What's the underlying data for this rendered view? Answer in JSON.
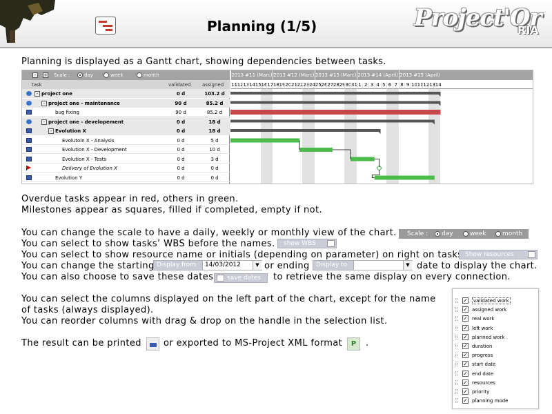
{
  "header": {
    "title": "Planning (1/5)",
    "brand": "Project'Or",
    "brand_sub": "RIA",
    "colors": {
      "bar_bg": "#a9a9a9",
      "green": "#4cbb4c",
      "red": "#c9474b",
      "summary": "#555555"
    }
  },
  "intro": "Planning is displayed as a Gantt chart, showing dependencies between tasks.",
  "gantt": {
    "scale_label": "Scale :",
    "scale_options": [
      "day",
      "week",
      "month"
    ],
    "scale_selected": "day",
    "col_task": "task",
    "col_validated": "validated",
    "col_assigned": "assigned",
    "weeks": [
      "2013 #11 (Marc)",
      "2013 #12 (Marc)",
      "2013 #13 (Marc)",
      "2013 #14 (April)",
      "2013 #15 (April)"
    ],
    "days": [
      "11",
      "12",
      "13",
      "14",
      "15",
      "16",
      "17",
      "18",
      "19",
      "20",
      "21",
      "22",
      "23",
      "24",
      "25",
      "26",
      "27",
      "28",
      "29",
      "30",
      "31",
      "1",
      "2",
      "3",
      "4",
      "5",
      "6",
      "7",
      "8",
      "9",
      "10",
      "11",
      "12",
      "13",
      "14"
    ],
    "rows": [
      {
        "name": "project one",
        "validated": "0 d",
        "assigned": "103.2 d",
        "style": "bold",
        "icon": "gear",
        "indent": 0,
        "toggle": "-"
      },
      {
        "name": "project one - maintenance",
        "validated": "90 d",
        "assigned": "85.2 d",
        "style": "bold",
        "icon": "gear",
        "indent": 1,
        "toggle": "-"
      },
      {
        "name": "bug fixing",
        "validated": "90 d",
        "assigned": "85.2 d",
        "style": "",
        "icon": "pc",
        "indent": 2,
        "toggle": ""
      },
      {
        "name": "project one - developement",
        "validated": "0 d",
        "assigned": "18 d",
        "style": "bold",
        "icon": "gear",
        "indent": 1,
        "toggle": "-"
      },
      {
        "name": "Evolution X",
        "validated": "0 d",
        "assigned": "18 d",
        "style": "bold",
        "icon": "pc",
        "indent": 2,
        "toggle": "-"
      },
      {
        "name": "Evolutoin X - Analysis",
        "validated": "0 d",
        "assigned": "5 d",
        "style": "",
        "icon": "pc",
        "indent": 3,
        "toggle": ""
      },
      {
        "name": "Evolution X - Development",
        "validated": "0 d",
        "assigned": "10 d",
        "style": "",
        "icon": "pc",
        "indent": 3,
        "toggle": ""
      },
      {
        "name": "Evolution X - Tests",
        "validated": "0 d",
        "assigned": "3 d",
        "style": "",
        "icon": "pc",
        "indent": 3,
        "toggle": ""
      },
      {
        "name": "Delivery of Evolution X",
        "validated": "0 d",
        "assigned": "0 d",
        "style": "italic",
        "icon": "flag",
        "indent": 3,
        "toggle": ""
      },
      {
        "name": "Evolution Y",
        "validated": "0 d",
        "assigned": "0 d",
        "style": "",
        "icon": "pc",
        "indent": 2,
        "toggle": ""
      }
    ]
  },
  "text": {
    "overdue": "Overdue tasks appear in red, others in green.",
    "milestones": "Milestones appear as squares, filled if completed, empty if not.",
    "scale_line": "You can change the scale to have a daily, weekly or monthly view of the chart.",
    "wbs_line": "You can select to show tasks’ WBS before the names.",
    "res_line": "You can select to show resource name or initials (depending on parameter) on right on tasks.",
    "date_line_a": "You can change the starting",
    "date_line_b": "or ending",
    "date_line_c": "date to display the chart.",
    "save_line_a": "You can also choose to save these dates",
    "save_line_b": "to retrieve the same display on every connection.",
    "cols_line1": "You can select the columns displayed on the left part of the chart, except for the name",
    "cols_line2": "of tasks (always displayed).",
    "reorder_line": "You can reorder columns with drag & drop on the handle in the selection list.",
    "print_line_a": "The result can be printed",
    "print_line_b": "or exported to MS-Project XML format",
    "print_line_c": "."
  },
  "widgets": {
    "scale_label": "Scale :",
    "scale_options": [
      "day",
      "week",
      "month"
    ],
    "show_wbs": "show WBS",
    "show_resources": "Show resources",
    "display_from": "Display from",
    "display_from_value": "14/03/2012",
    "display_to": "Display to",
    "display_to_value": "",
    "save_dates": "save dates",
    "export_label": "P"
  },
  "column_selector": [
    {
      "label": "validated work",
      "checked": true
    },
    {
      "label": "assigned work",
      "checked": true
    },
    {
      "label": "real work",
      "checked": true
    },
    {
      "label": "left work",
      "checked": true
    },
    {
      "label": "planned work",
      "checked": true
    },
    {
      "label": "duration",
      "checked": true
    },
    {
      "label": "progress",
      "checked": true
    },
    {
      "label": "start date",
      "checked": true
    },
    {
      "label": "end date",
      "checked": true
    },
    {
      "label": "resources",
      "checked": true
    },
    {
      "label": "priority",
      "checked": true
    },
    {
      "label": "planning mode",
      "checked": true
    }
  ]
}
